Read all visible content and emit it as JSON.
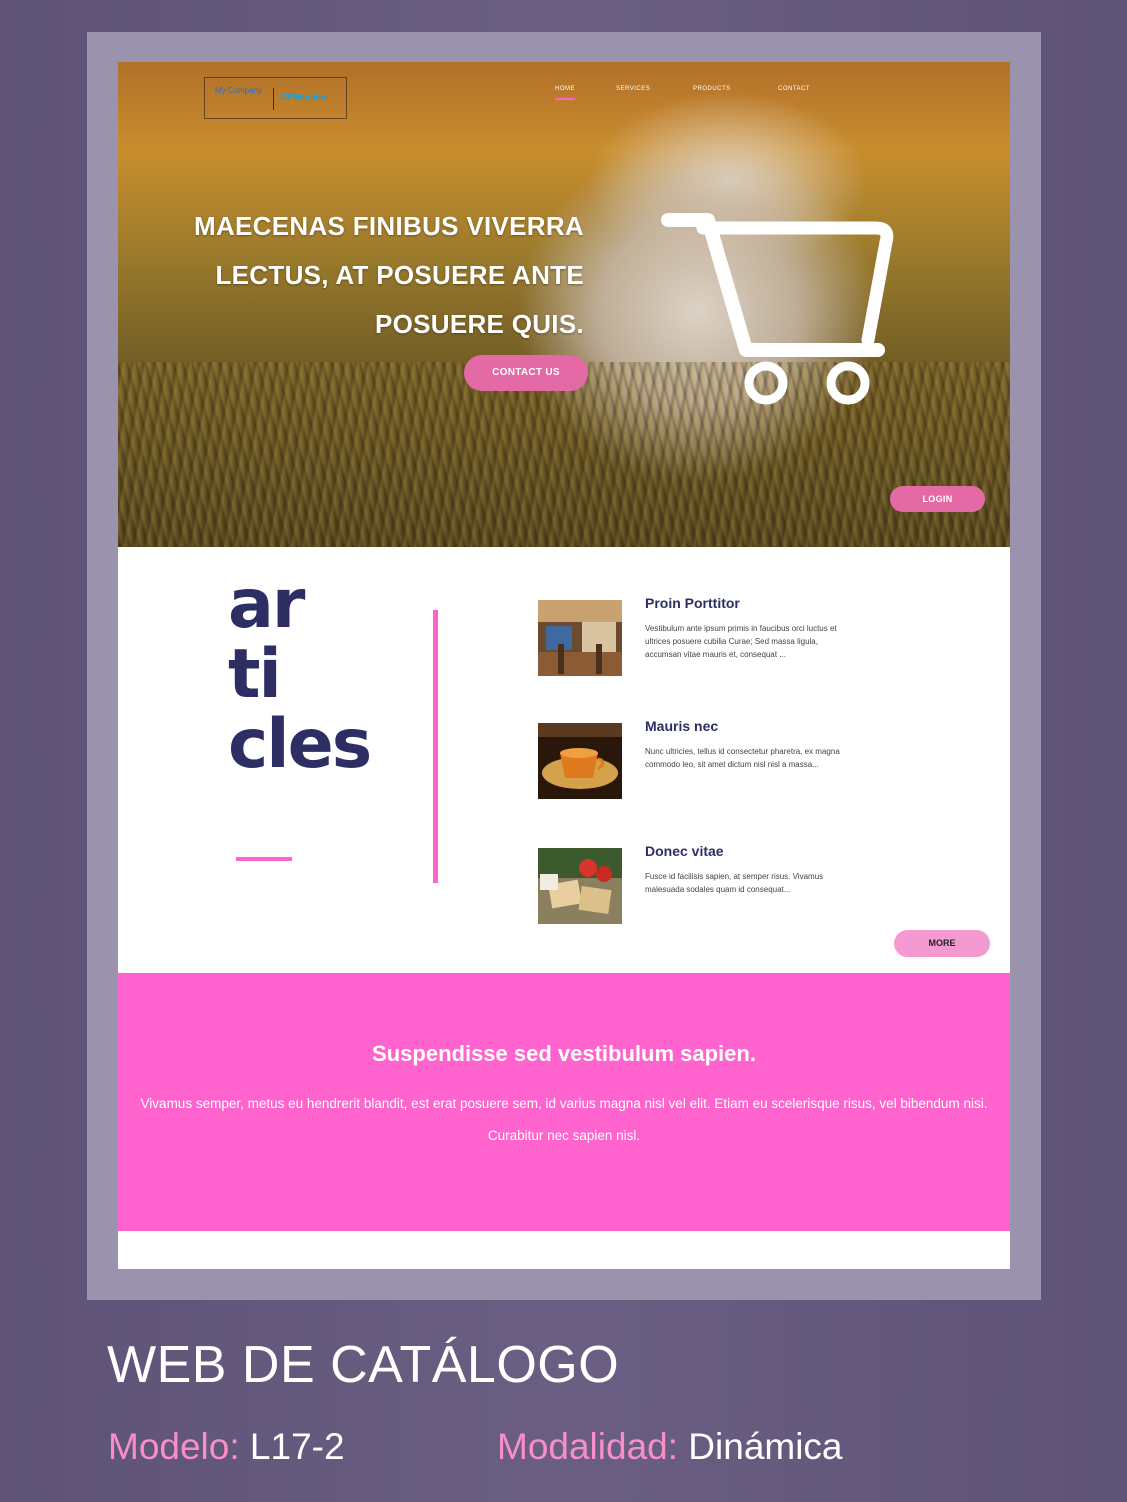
{
  "hero": {
    "logo_left": "My Company",
    "logo_right": "CPWonline",
    "nav": [
      "HOME",
      "SERVICES",
      "PRODUCTS",
      "CONTACT"
    ],
    "title_lines": [
      "MAECENAS FINIBUS VIVERRA",
      "LECTUS, AT POSUERE ANTE",
      "POSUERE QUIS."
    ],
    "contact_button": "CONTACT US",
    "login_button": "LOGIN",
    "cart_icon": "shopping-cart-icon"
  },
  "articles": {
    "heading_lines": [
      "ar",
      "ti",
      "cles"
    ],
    "items": [
      {
        "title": "Proin Porttitor",
        "description": "Vestibulum ante ipsum primis in faucibus orci luctus et ultrices posuere cubilia Curae; Sed massa ligula, accumsan vitae mauris et, consequat ...",
        "image": "dining-room-thumbnail"
      },
      {
        "title": "Mauris nec",
        "description": "Nunc ultricies, tellus id consectetur pharetra, ex magna commodo leo, sit amet dictum nisl nisl a massa...",
        "image": "coffee-cup-thumbnail"
      },
      {
        "title": "Donec vitae",
        "description": "Fusce id facilisis sapien, at semper risus. Vivamus malesuada sodales quam id consequat...",
        "image": "crackers-tomatoes-thumbnail"
      }
    ],
    "more_button": "MORE"
  },
  "band": {
    "title": "Suspendisse sed vestibulum sapien.",
    "text": "Vivamus semper, metus eu hendrerit blandit, est erat posuere sem, id varius magna nisl vel elit. Etiam eu scelerisque risus, vel bibendum nisi. Curabitur nec sapien nisl."
  },
  "caption": {
    "title": "WEB DE CATÁLOGO",
    "model_label": "Modelo:",
    "model_value": "L17-2",
    "mode_label": "Modalidad:",
    "mode_value": "Dinámica"
  },
  "colors": {
    "accent": "#ff63cd",
    "navy": "#2d2e63",
    "background": "#5e5377"
  }
}
